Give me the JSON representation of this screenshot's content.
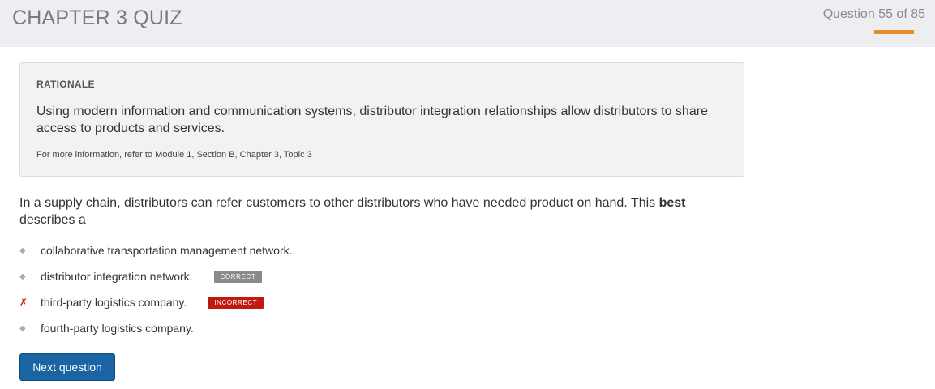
{
  "header": {
    "title": "CHAPTER 3 QUIZ",
    "progress_text": "Question 55 of 85",
    "progress_fraction": 0.647
  },
  "rationale": {
    "heading": "RATIONALE",
    "body": "Using modern information and communication systems, distributor integration relationships allow distributors to share access to products and services.",
    "reference": "For more information, refer to Module 1, Section B, Chapter 3, Topic 3"
  },
  "question": {
    "text_before": "In a supply chain, distributors can refer customers to other distributors who have needed product on hand. This ",
    "emphasis": "best",
    "text_after": " describes a"
  },
  "options": [
    {
      "label": "collaborative transportation management network.",
      "marker": "◆",
      "badge": ""
    },
    {
      "label": "distributor integration network.",
      "marker": "◆",
      "badge": "CORRECT"
    },
    {
      "label": "third-party logistics company.",
      "marker": "✗",
      "badge": "INCORRECT"
    },
    {
      "label": "fourth-party logistics company.",
      "marker": "◆",
      "badge": ""
    }
  ],
  "next_button": {
    "label": "Next question"
  },
  "colors": {
    "accent_orange": "#e8892b",
    "correct_badge": "#8a8a8a",
    "incorrect_badge": "#c0190e",
    "button_blue": "#1a64a4"
  }
}
